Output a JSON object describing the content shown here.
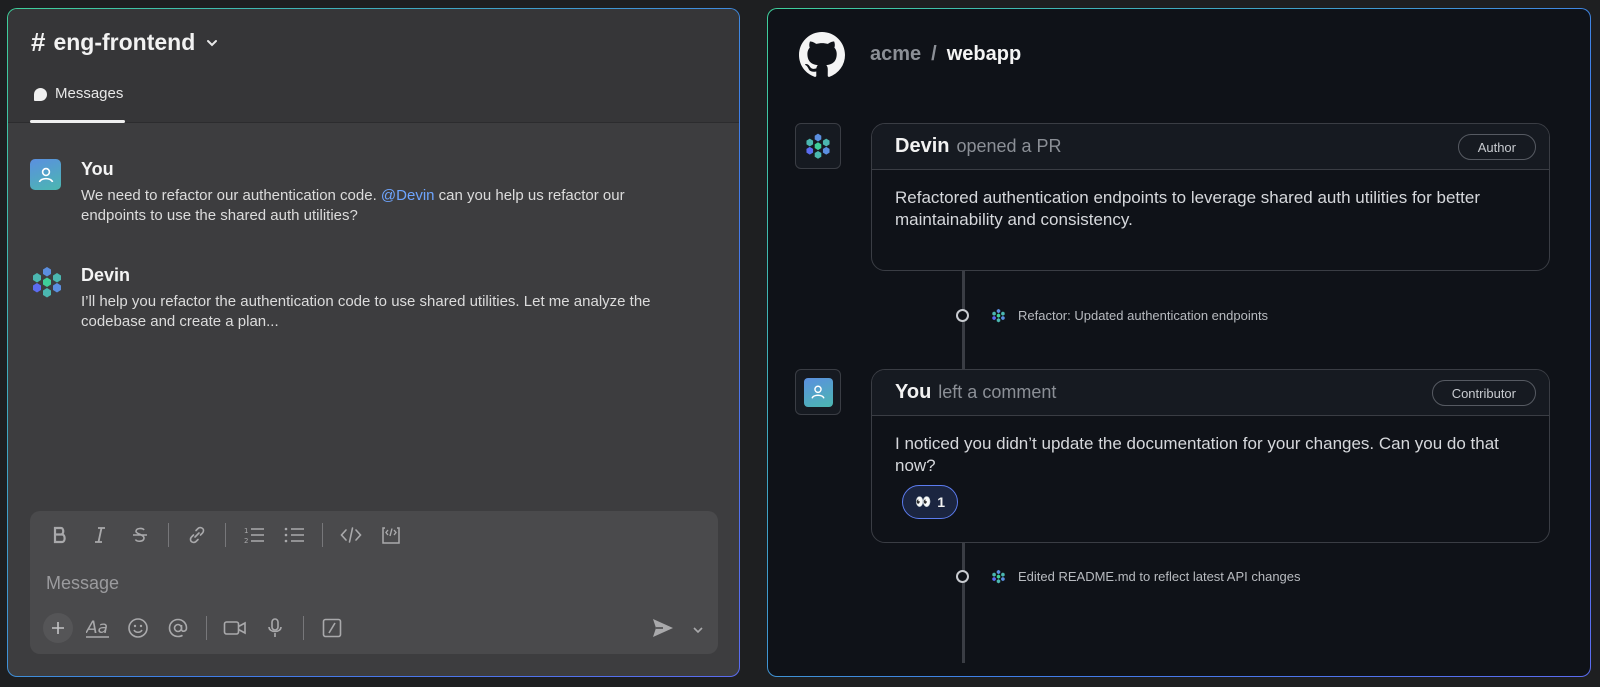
{
  "slack": {
    "channel_hash": "#",
    "channel_name": "eng-frontend",
    "tab_label": "Messages",
    "messages": [
      {
        "author": "You",
        "text_before": "We need to refactor our authentication code. ",
        "mention": "@Devin",
        "text_after": " can you help us refactor our endpoints to use the shared auth utilities?"
      },
      {
        "author": "Devin",
        "text": "I’ll help you refactor the authentication code to use shared utilities. Let me analyze the codebase and create a plan..."
      }
    ],
    "composer": {
      "placeholder": "Message",
      "format_icons": [
        "bold-icon",
        "italic-icon",
        "strikethrough-icon",
        "link-icon",
        "ordered-list-icon",
        "bullet-list-icon",
        "code-icon",
        "code-block-icon"
      ],
      "action_icons": [
        "plus-icon",
        "text-format-icon",
        "emoji-icon",
        "mention-icon",
        "video-icon",
        "microphone-icon",
        "slash-command-icon",
        "send-icon",
        "chevron-down-icon"
      ]
    }
  },
  "github": {
    "owner": "acme",
    "separator": "/",
    "repo": "webapp",
    "pr_card": {
      "author": "Devin",
      "action": "opened a PR",
      "role": "Author",
      "body": "Refactored authentication endpoints to leverage shared auth utilities for better maintainability and consistency."
    },
    "event_1": "Refactor: Updated authentication endpoints",
    "comment_card": {
      "author": "You",
      "action": "left a comment",
      "role": "Contributor",
      "body": "I noticed you didn’t update the documentation for your changes. Can you do that now?",
      "reaction_emoji": "👀",
      "reaction_count": "1"
    },
    "event_2": "Edited README.md to reflect latest API changes"
  },
  "colors": {
    "mention": "#6ea5ff",
    "accent_border": "#3f7fe8",
    "reaction_border": "#5c7cf0"
  }
}
